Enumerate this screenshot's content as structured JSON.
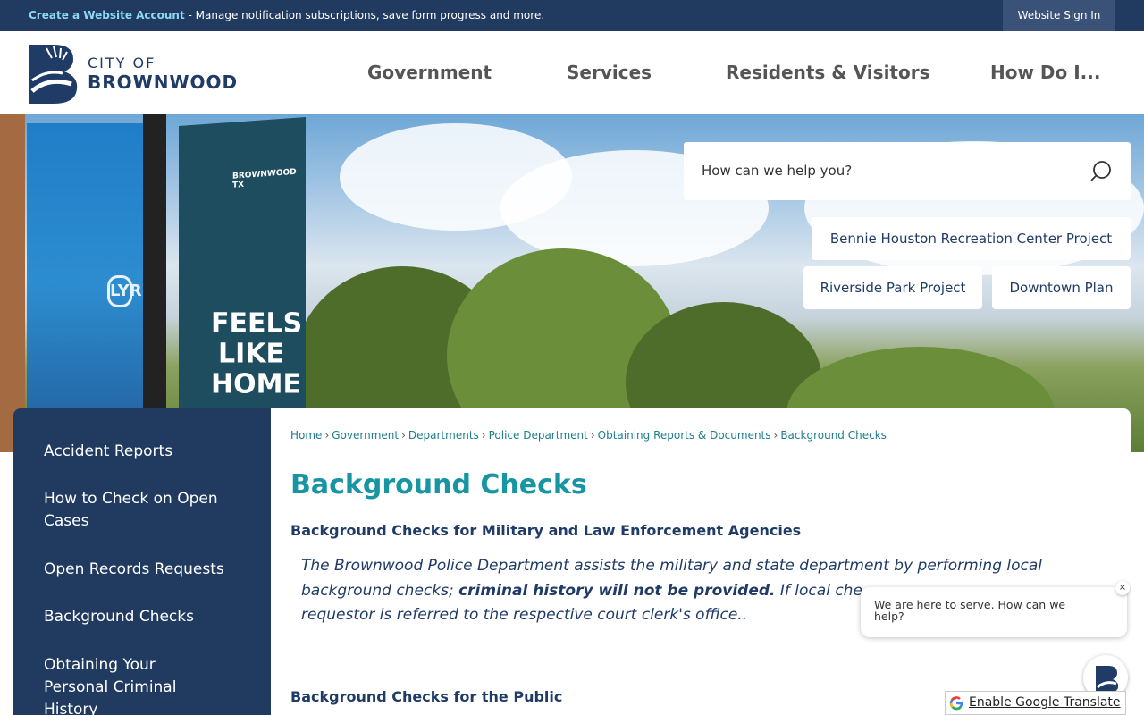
{
  "topbar": {
    "create_account_link": "Create a Website Account",
    "create_account_text": " - Manage notification subscriptions, save form progress and more.",
    "sign_in": "Website Sign In"
  },
  "header": {
    "logo_city": "CITY OF",
    "logo_name": "BROWNWOOD",
    "nav": [
      "Government",
      "Services",
      "Residents & Visitors",
      "How Do I..."
    ]
  },
  "hero": {
    "search_placeholder": "How can we help you?",
    "quick_links": [
      "Bennie Houston Recreation Center Project",
      "Riverside Park Project",
      "Downtown Plan"
    ],
    "banner_text": "FEELS LIKE HOME",
    "banner_brand": "BROWNWOOD TX",
    "lyric_sign": "LYRIC"
  },
  "sidebar": {
    "items": [
      "Accident Reports",
      "How to Check on Open Cases",
      "Open Records Requests",
      "Background Checks",
      "Obtaining Your Personal Criminal History"
    ]
  },
  "breadcrumbs": [
    "Home",
    "Government",
    "Departments",
    "Police Department",
    "Obtaining Reports & Documents",
    "Background Checks"
  ],
  "content": {
    "title": "Background Checks",
    "section1_heading": "Background Checks for Military and Law Enforcement Agencies",
    "para_part1": "The Brownwood Police Department assists the military and state department by performing local background checks; ",
    "para_bold": "criminal history will not be provided.",
    "para_part2": " If local che",
    "para_part3": "requestor is referred to the respective court clerk's office..",
    "section2_heading": "Background Checks for the Public"
  },
  "chat": {
    "message": "We are here to serve. How can we help?",
    "close": "×"
  },
  "translate": {
    "label": "Enable Google Translate"
  },
  "colors": {
    "navy": "#203a60",
    "teal_title": "#1795a3",
    "link_teal": "#1b7d8f"
  }
}
